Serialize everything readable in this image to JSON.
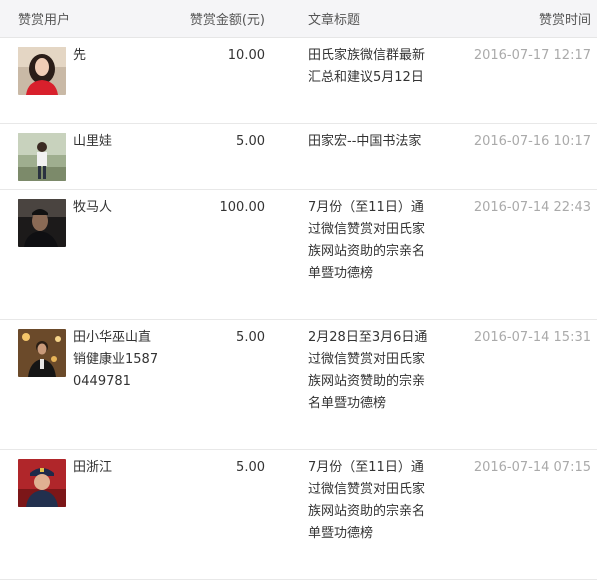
{
  "table": {
    "headers": {
      "user": "赞赏用户",
      "amount": "赞赏金额(元)",
      "title": "文章标题",
      "time": "赞赏时间"
    },
    "rows": [
      {
        "user": "先",
        "amount": "10.00",
        "title": "田氏家族微信群最新汇总和建议5月12日",
        "time": "2016-07-17 12:17",
        "avatar": "portrait-woman-red-dress"
      },
      {
        "user": "山里娃",
        "amount": "5.00",
        "title": "田家宏--中国书法家",
        "time": "2016-07-16 10:17",
        "avatar": "portrait-man-outdoors"
      },
      {
        "user": "牧马人",
        "amount": "100.00",
        "title": "7月份（至11日）通过微信赞赏对田氏家族网站资助的宗亲名单暨功德榜",
        "time": "2016-07-14 22:43",
        "avatar": "portrait-man-dark"
      },
      {
        "user": "田小华巫山直销健康业15870449781",
        "amount": "5.00",
        "title": "2月28日至3月6日通过微信赞赏对田氏家族网站资赞助的宗亲名单暨功德榜",
        "time": "2016-07-14 15:31",
        "avatar": "portrait-man-lights"
      },
      {
        "user": "田浙江",
        "amount": "5.00",
        "title": "7月份（至11日）通过微信赞赏对田氏家族网站资助的宗亲名单暨功德榜",
        "time": "2016-07-14 07:15",
        "avatar": "portrait-man-uniform-cap"
      }
    ]
  }
}
